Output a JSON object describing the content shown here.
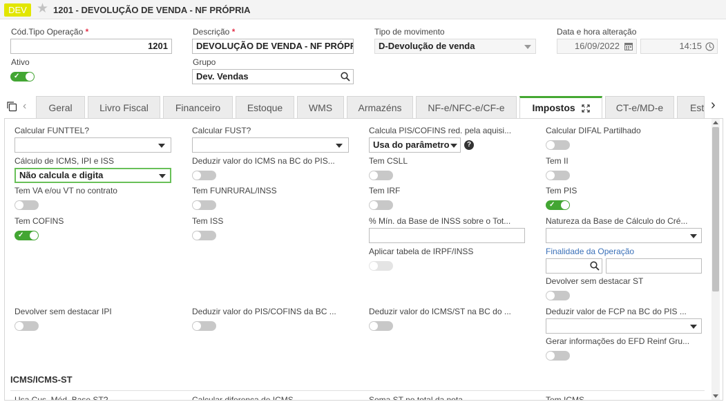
{
  "header": {
    "badge": "DEV",
    "title": "1201 - DEVOLUÇÃO DE VENDA - NF PRÓPRIA"
  },
  "form": {
    "cod_label": "Cód.Tipo Operação",
    "cod_value": "1201",
    "descricao_label": "Descrição",
    "descricao_value": "DEVOLUÇÃO DE VENDA - NF PRÓPRI",
    "tipo_label": "Tipo de movimento",
    "tipo_value": "D-Devolução de venda",
    "data_label": "Data e hora alteração",
    "data_value": "16/09/2022",
    "hora_value": "14:15",
    "ativo_label": "Ativo",
    "grupo_label": "Grupo",
    "grupo_value": "Dev. Vendas",
    "required_mark": "*"
  },
  "tabs": [
    "Geral",
    "Livro Fiscal",
    "Financeiro",
    "Estoque",
    "WMS",
    "Armazéns",
    "NF-e/NFC-e/CF-e",
    "Impostos",
    "CT-e/MD-e",
    "Est"
  ],
  "impostos": {
    "funtel_label": "Calcular FUNTTEL?",
    "fust_label": "Calcular FUST?",
    "pis_cofins_red_label": "Calcula PIS/COFINS red. pela aquisi...",
    "pis_cofins_red_value": "Usa do parâmetro",
    "difal_label": "Calcular DIFAL Partilhado",
    "calc_icms_label": "Cálculo de ICMS, IPI e ISS",
    "calc_icms_value": "Não calcula e digita",
    "deduzir_icms_pis_label": "Deduzir valor do ICMS na BC do PIS...",
    "csll_label": "Tem CSLL",
    "ii_label": "Tem II",
    "va_vt_label": "Tem VA e/ou VT no contrato",
    "funrural_label": "Tem FUNRURAL/INSS",
    "irf_label": "Tem IRF",
    "pis_label": "Tem PIS",
    "cofins_label": "Tem COFINS",
    "iss_label": "Tem ISS",
    "min_inss_label": "% Mín. da Base de INSS sobre o Tot...",
    "natureza_label": "Natureza da Base de Cálculo do Cré...",
    "irpf_label": "Aplicar tabela de IRPF/INSS",
    "finalidade_label": "Finalidade da Operação",
    "devolver_st_label": "Devolver sem destacar ST",
    "devolver_ipi_label": "Devolver sem destacar IPI",
    "deduzir_pis_cofins_label": "Deduzir valor do PIS/COFINS da BC ...",
    "deduzir_icms_st_label": "Deduzir valor do ICMS/ST na BC do ...",
    "deduzir_fcp_label": "Deduzir valor de FCP na BC do PIS ...",
    "efd_reinf_label": "Gerar informações do EFD Reinf Gru...",
    "section_icms": "ICMS/ICMS-ST",
    "usa_cus_label": "Usa Cus. Méd. Base ST?",
    "calc_dif_label": "Calcular diferença de ICMS",
    "soma_st_label": "Soma ST no total da nota",
    "tem_icms_label": "Tem ICMS",
    "check_glyph": "✓"
  },
  "colors": {
    "accent_green": "#43a633",
    "badge_yellow": "#e2e600",
    "link_blue": "#3a70b8",
    "required_red": "#e3324a"
  },
  "icons": [
    "star-icon",
    "search-icon",
    "calendar-icon",
    "clock-icon",
    "copy-icon",
    "chevron-left-icon",
    "chevron-right-icon",
    "expand-icon",
    "help-icon"
  ]
}
